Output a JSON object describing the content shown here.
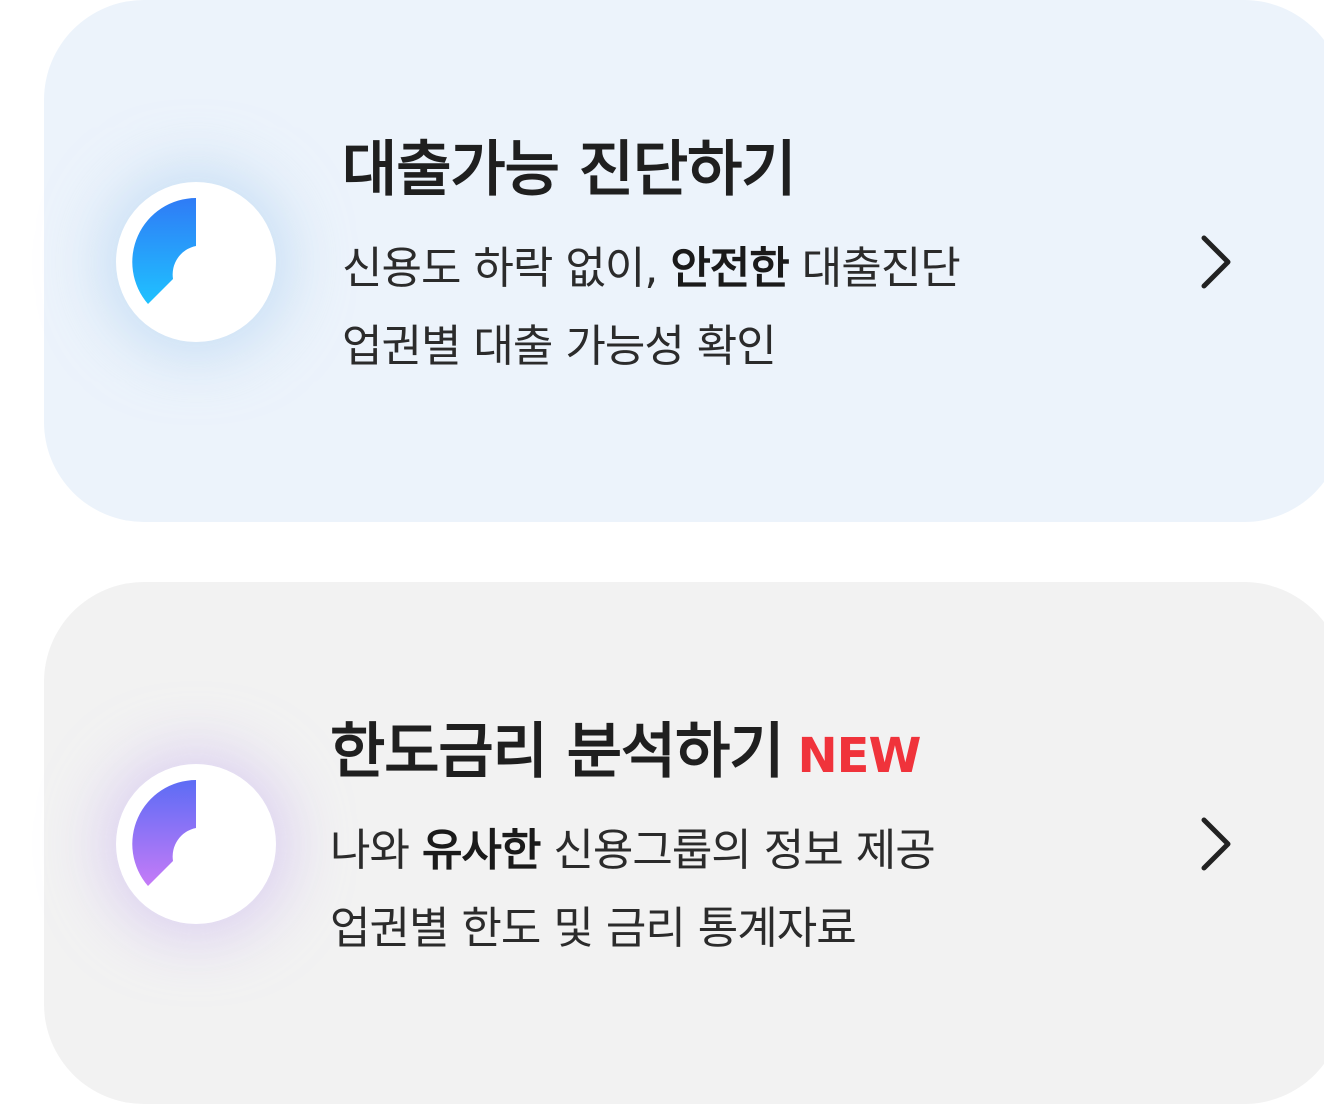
{
  "cards": [
    {
      "title": "대출가능 진단하기",
      "badge": "",
      "line1": {
        "prefix": "신용도 하락 없이, ",
        "emphasis": "안전한",
        "suffix": " 대출진단"
      },
      "line2": "업권별 대출 가능성 확인",
      "icon": "loader-ring-blue-icon",
      "gradient": [
        "#2f7bf6",
        "#1fc2ff"
      ]
    },
    {
      "title": "한도금리 분석하기",
      "badge": "NEW",
      "line1": {
        "prefix": "나와 ",
        "emphasis": "유사한",
        "suffix": " 신용그룹의 정보 제공"
      },
      "line2": "업권별 한도 및 금리 통계자료",
      "icon": "loader-ring-purple-icon",
      "gradient": [
        "#5c6cf5",
        "#c57bf7"
      ]
    }
  ],
  "colors": {
    "card1_bg": "#ecf3fb",
    "card2_bg": "#f2f2f2",
    "badge": "#f0333b",
    "chevron": "#222222"
  }
}
